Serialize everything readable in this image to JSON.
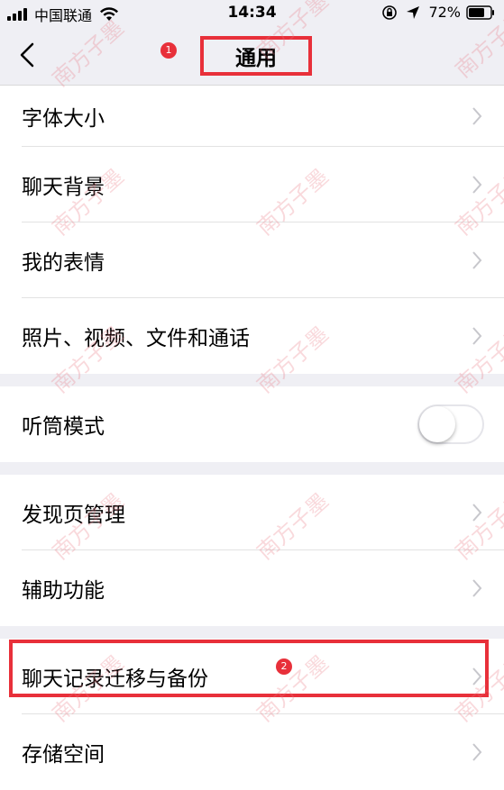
{
  "status_bar": {
    "carrier": "中国联通",
    "time": "14:34",
    "battery": "72%"
  },
  "nav": {
    "title": "通用",
    "badge_1": "1"
  },
  "groups": [
    {
      "items": [
        {
          "label": "字体大小"
        },
        {
          "label": "聊天背景"
        },
        {
          "label": "我的表情"
        },
        {
          "label": "照片、视频、文件和通话"
        }
      ]
    },
    {
      "items": [
        {
          "label": "听筒模式",
          "toggle": false
        }
      ]
    },
    {
      "items": [
        {
          "label": "发现页管理"
        },
        {
          "label": "辅助功能"
        }
      ]
    },
    {
      "items": [
        {
          "label": "聊天记录迁移与备份"
        },
        {
          "label": "存储空间"
        }
      ]
    }
  ],
  "annotation": {
    "badge_2": "2"
  },
  "watermark": "南方子墨",
  "colors": {
    "highlight": "#e8303a",
    "background": "#efeff4"
  }
}
